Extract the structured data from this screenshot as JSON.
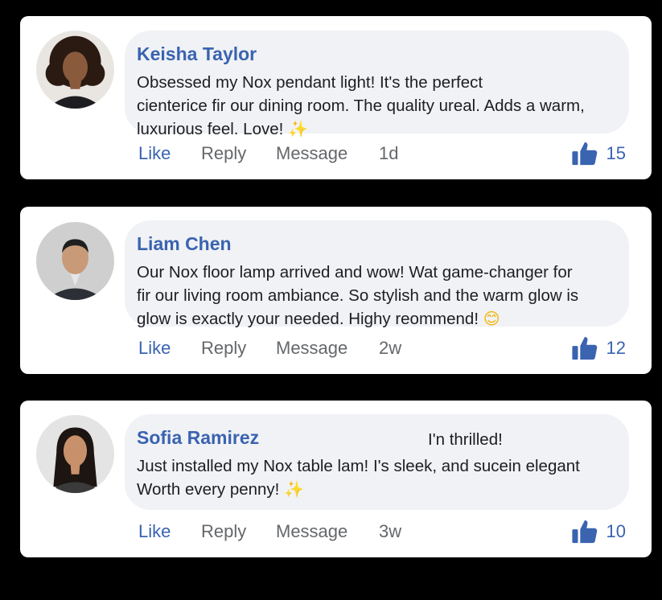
{
  "comments": [
    {
      "name": "Keisha Taylor",
      "lines": [
        "Obsessed my Nox pendant light! It's the perfect",
        "cienterice fir our dining room. The quality ureal. Adds a warm,",
        "luxurious feel. Love! "
      ],
      "note": "",
      "emoji": "✨",
      "actions": {
        "like": "Like",
        "reply": "Reply",
        "message": "Message",
        "time": "1d"
      },
      "like_count": "15"
    },
    {
      "name": "Liam Chen",
      "lines": [
        "Our Nox floor lamp arrived and wow! Wat game-changer for",
        "fir our living room ambiance. So stylish and the warm glow is",
        "glow is exactly your needed. Highy reommend! "
      ],
      "note": "",
      "emoji": "😊",
      "actions": {
        "like": "Like",
        "reply": "Reply",
        "message": "Message",
        "time": "2w"
      },
      "like_count": "12"
    },
    {
      "name": "Sofia Ramirez",
      "lines": [
        "Just installed my Nox table lam! I's sleek, and sucein elegant",
        "Worth every penny! "
      ],
      "note": "I'n thrilled!",
      "emoji": "✨",
      "actions": {
        "like": "Like",
        "reply": "Reply",
        "message": "Message",
        "time": "3w"
      },
      "like_count": "10"
    }
  ],
  "colors": {
    "accent": "#3a63b0",
    "bubble": "#f0f2f5",
    "muted": "#65676b",
    "background": "#000000",
    "card": "#ffffff"
  },
  "icons": {
    "like_count": "thumbs-up-icon"
  }
}
